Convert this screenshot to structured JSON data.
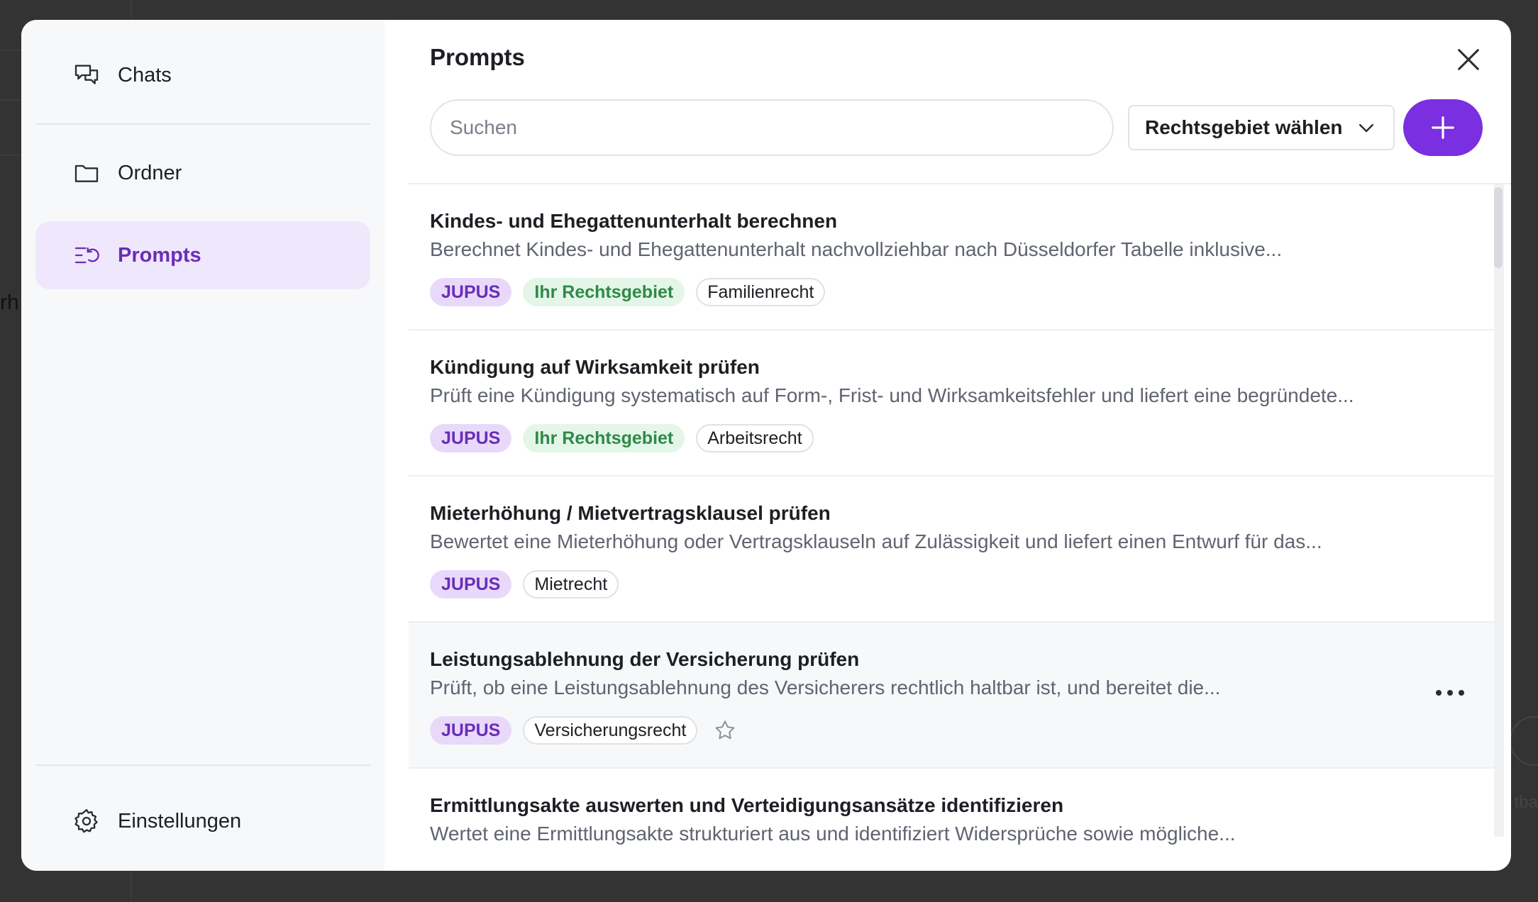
{
  "background": {
    "peek_left": "rh",
    "peek_right": "tba"
  },
  "sidebar": {
    "items": [
      {
        "label": "Chats",
        "icon": "chat-bubbles-icon",
        "active": false
      },
      {
        "label": "Ordner",
        "icon": "folder-icon",
        "active": false
      },
      {
        "label": "Prompts",
        "icon": "prompt-list-icon",
        "active": true
      }
    ],
    "footer": {
      "label": "Einstellungen",
      "icon": "gear-icon"
    }
  },
  "main": {
    "title": "Prompts",
    "search": {
      "placeholder": "Suchen",
      "value": ""
    },
    "filter": {
      "label": "Rechtsgebiet wählen"
    },
    "add_button": {
      "icon": "plus-icon"
    }
  },
  "prompts": [
    {
      "title": "Kindes- und Ehegattenunterhalt berechnen",
      "description": "Berechnet Kindes- und Ehegattenunterhalt nachvollziehbar nach Düsseldorfer Tabelle inklusive...",
      "tags": {
        "source": "JUPUS",
        "own": "Ihr Rechtsgebiet",
        "area": "Familienrecht"
      }
    },
    {
      "title": "Kündigung auf Wirksamkeit prüfen",
      "description": "Prüft eine Kündigung systematisch auf Form-, Frist- und Wirksamkeitsfehler und liefert eine begründete...",
      "tags": {
        "source": "JUPUS",
        "own": "Ihr Rechtsgebiet",
        "area": "Arbeitsrecht"
      }
    },
    {
      "title": "Mieterhöhung / Mietvertragsklausel prüfen",
      "description": "Bewertet eine Mieterhöhung oder Vertragsklauseln auf Zulässigkeit und liefert einen Entwurf für das...",
      "tags": {
        "source": "JUPUS",
        "area": "Mietrecht"
      }
    },
    {
      "title": "Leistungsablehnung der Versicherung prüfen",
      "description": "Prüft, ob eine Leistungsablehnung des Versicherers rechtlich haltbar ist, und bereitet die...",
      "tags": {
        "source": "JUPUS",
        "area": "Versicherungsrecht"
      },
      "hovered": true
    },
    {
      "title": "Ermittlungsakte auswerten und Verteidigungsansätze identifizieren",
      "description": "Wertet eine Ermittlungsakte strukturiert aus und identifiziert Widersprüche sowie mögliche..."
    }
  ],
  "colors": {
    "accent": "#7a2fe0",
    "active_bg": "#efe7fc",
    "green_tag": "#2e8a46"
  }
}
